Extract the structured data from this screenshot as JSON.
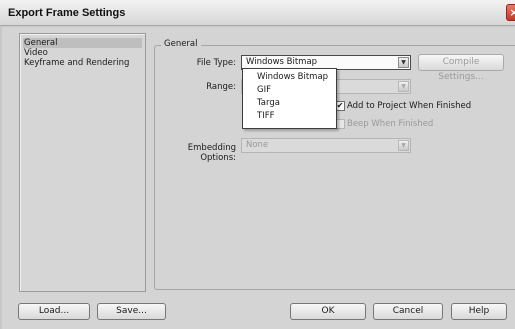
{
  "window": {
    "title": "Export Frame Settings",
    "close_glyph": "×"
  },
  "sidebar": {
    "items": [
      {
        "label": "General",
        "selected": true
      },
      {
        "label": "Video",
        "selected": false
      },
      {
        "label": "Keyframe and Rendering",
        "selected": false
      }
    ]
  },
  "general": {
    "group_title": "General",
    "file_type_label": "File Type:",
    "file_type_value": "Windows Bitmap",
    "compile_settings_label": "Compile Settings...",
    "range_label": "Range:",
    "range_value": "",
    "add_to_project_label": "Add to Project When Finished",
    "add_to_project_checked": true,
    "beep_label": "Beep When Finished",
    "beep_checked": false,
    "embedding_label": "Embedding Options:",
    "embedding_value": "None"
  },
  "file_type_dropdown": {
    "options": [
      "Windows Bitmap",
      "GIF",
      "Targa",
      "TIFF"
    ]
  },
  "footer": {
    "load_label": "Load...",
    "save_label": "Save...",
    "ok_label": "OK",
    "cancel_label": "Cancel",
    "help_label": "Help"
  },
  "icons": {
    "dropdown_arrow": "▼",
    "checkmark": "✔"
  }
}
